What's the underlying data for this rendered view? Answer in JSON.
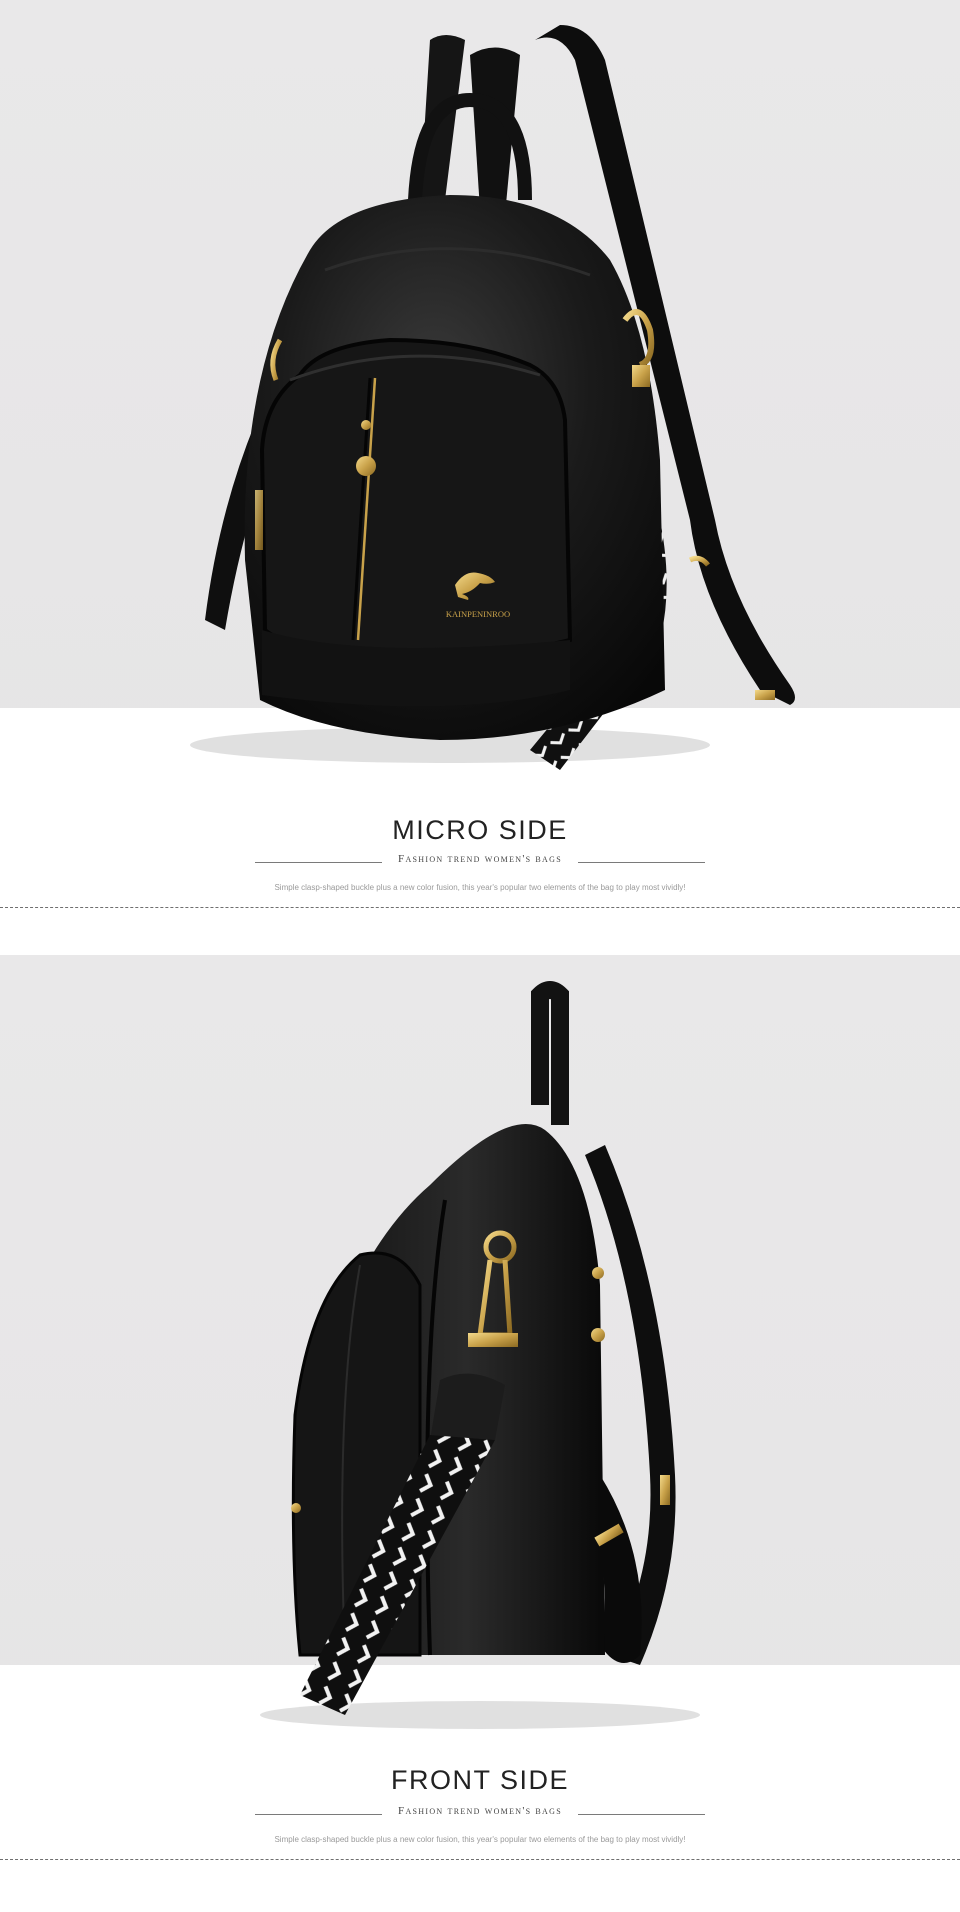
{
  "sections": [
    {
      "title": "MICRO SIDE",
      "subtitle": "Fashion trend women's bags",
      "description": "Simple clasp-shaped buckle plus a new color fusion, this year's popular two elements of the bag to play most vividly!",
      "brand_logo_text": "KAINPENINROO"
    },
    {
      "title": "FRONT SIDE",
      "subtitle": "Fashion trend women's bags",
      "description": "Simple clasp-shaped buckle plus a new color fusion, this year's popular two elements of the bag to play most vividly!"
    }
  ],
  "colors": {
    "backdrop": "#e7e6e7",
    "leather": "#141414",
    "hardware_gold": "#c9a24a",
    "strap_pattern": "#f2f2f2"
  }
}
